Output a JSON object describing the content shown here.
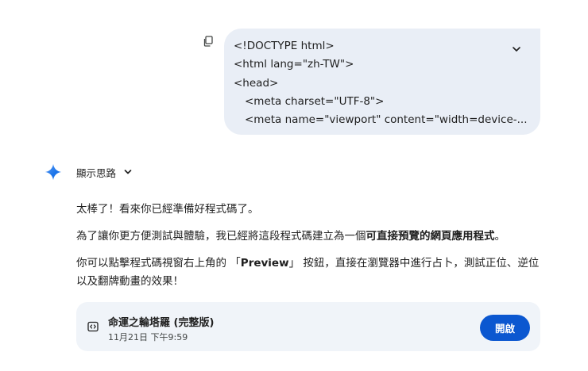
{
  "user_message": {
    "lines": [
      "<!DOCTYPE html>",
      "<html lang=\"zh-TW\">",
      "<head>",
      "<meta charset=\"UTF-8\">",
      "<meta name=\"viewport\" content=\"width=device-..."
    ],
    "copy_icon": "copy-icon",
    "expand_icon": "chevron-down-icon"
  },
  "thinking": {
    "label": "顯示思路",
    "icon": "gemini-spark-icon",
    "spark_colors": [
      "#4285f4",
      "#1a73e8",
      "#5a9cf8"
    ]
  },
  "response": {
    "para1": "太棒了！看來你已經準備好程式碼了。",
    "para2_prefix": "為了讓你更方便測試與體驗，我已經將這段程式碼建立為一個",
    "para2_bold": "可直接預覽的網頁應用程式",
    "para2_suffix": "。",
    "para3_prefix": "你可以點擊程式碼視窗右上角的 「",
    "para3_bold": "Preview",
    "para3_suffix": "」 按鈕，直接在瀏覽器中進行占卜，測試正位、逆位以及翻牌動畫的效果！"
  },
  "artifact_card": {
    "title": "命運之輪塔羅 (完整版)",
    "date": "11月21日 下午9:59",
    "open_label": "開啟",
    "icon": "code-icon",
    "button_color": "#0b57d0"
  }
}
